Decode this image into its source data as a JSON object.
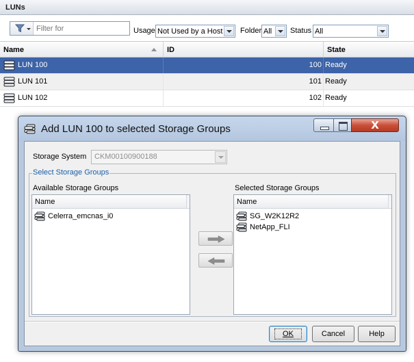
{
  "panel": {
    "title": "LUNs"
  },
  "toolbar": {
    "filter_icon": "funnel-icon",
    "filter_placeholder": "Filter for",
    "usage_label": "Usage",
    "usage_value": "Not Used by a Host",
    "folder_label": "Folder",
    "folder_value": "All",
    "status_label": "Status",
    "status_value": "All"
  },
  "grid": {
    "columns": [
      "Name",
      "ID",
      "State"
    ],
    "rows": [
      {
        "name": "LUN 100",
        "id": "100",
        "state": "Ready",
        "selected": true
      },
      {
        "name": "LUN 101",
        "id": "101",
        "state": "Ready",
        "selected": false
      },
      {
        "name": "LUN 102",
        "id": "102",
        "state": "Ready",
        "selected": false
      }
    ]
  },
  "dialog": {
    "title": "Add LUN 100 to selected Storage Groups",
    "storage_system_label": "Storage System",
    "storage_system_value": "CKM00100900188",
    "group_legend": "Select Storage Groups",
    "available_label": "Available Storage Groups",
    "selected_label": "Selected Storage Groups",
    "list_header": "Name",
    "available_items": [
      "Celerra_emcnas_i0"
    ],
    "selected_items": [
      "SG_W2K12R2",
      "NetApp_FLI"
    ],
    "close_glyph": "X",
    "ok_label": "OK",
    "cancel_label": "Cancel",
    "help_label": "Help"
  },
  "colors": {
    "selected_row": "#3d63a8",
    "group_legend": "#1c5ea8",
    "titlebar": "#b8c8dd",
    "close_button": "#c9503a"
  }
}
